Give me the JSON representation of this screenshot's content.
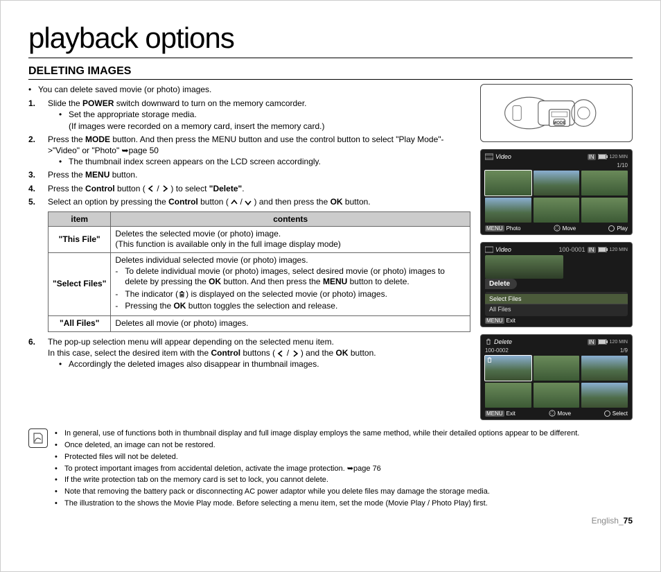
{
  "title": "playback options",
  "subtitle": "DELETING IMAGES",
  "intro_bullet": "You can delete saved movie (or photo) images.",
  "steps": [
    {
      "num": "1.",
      "parts": [
        "Slide the ",
        "POWER",
        " switch downward to turn on the memory camcorder."
      ],
      "subs": [
        [
          "Set the appropriate storage media."
        ],
        [
          "(If images were recorded on a memory card, insert the memory card.)"
        ]
      ]
    },
    {
      "num": "2.",
      "parts": [
        "Press the ",
        "MODE",
        " button. And then press the MENU button and use the control button to select \"Play Mode\"->\"Video\" or \"Photo\" ➥page 50"
      ],
      "subs": [
        [
          "The thumbnail index screen appears on the LCD screen accordingly."
        ]
      ]
    },
    {
      "num": "3.",
      "parts": [
        "Press the ",
        "MENU",
        " button."
      ]
    },
    {
      "num": "4.",
      "parts_a": "Press the ",
      "parts_b": "Control",
      "parts_c": " button ( ",
      "parts_d": " ) to select ",
      "parts_e": "\"Delete\"",
      "parts_f": "."
    },
    {
      "num": "5.",
      "parts_a": "Select an option by pressing the ",
      "parts_b": "Control",
      "parts_c": " button ( ",
      "parts_d": " ) and then press the ",
      "parts_e": "OK",
      "parts_f": " button."
    }
  ],
  "table": {
    "head_item": "item",
    "head_contents": "contents",
    "rows": [
      {
        "item": "\"This File\"",
        "lines": [
          "Deletes the selected movie (or photo) image.",
          "(This function is available only in the full image display mode)"
        ]
      },
      {
        "item": "\"Select Files\"",
        "intro": "Deletes individual selected movie (or photo) images.",
        "dashes": [
          {
            "pre": "To delete individual movie (or photo) images, select desired movie (or photo) images to delete by pressing the ",
            "bold1": "OK",
            "mid": " button. And then press the ",
            "bold2": "MENU",
            "post": " button to delete."
          },
          {
            "pre": "The indicator (",
            "icon": "trash",
            "post": ") is displayed on the selected movie (or photo) images."
          },
          {
            "pre": "Pressing the ",
            "bold1": "OK",
            "post": " button toggles the selection and release."
          }
        ]
      },
      {
        "item": "\"All Files\"",
        "lines": [
          "Deletes all movie (or photo) images."
        ]
      }
    ]
  },
  "step6": {
    "num": "6.",
    "line1_a": "The pop-up selection menu will appear depending on the selected menu item.",
    "line2_a": "In this case, select the desired item with the ",
    "line2_b": "Control",
    "line2_c": " buttons ( ",
    "line2_d": " ) and the ",
    "line2_e": "OK",
    "line2_f": " button.",
    "sub": "Accordingly the deleted images also disappear in thumbnail images."
  },
  "notes": [
    "In general, use of functions both in thumbnail display and full image display employs the same method, while their detailed options appear to be different.",
    "Once deleted, an image can not be restored.",
    "Protected files will not be deleted.",
    "To protect important images from accidental deletion, activate the image protection. ➥page 76",
    "If the write protection tab on the memory card is set to lock, you cannot delete.",
    "Note that removing the battery pack or disconnecting AC power adaptor while you delete files may damage the storage media.",
    "The illustration to the shows the Movie Play mode. Before selecting a menu item, set the mode (Movie Play / Photo Play) first."
  ],
  "footer_lang": "English_",
  "footer_page": "75",
  "lcd1": {
    "title": "Video",
    "counter": "1/10",
    "min": "120 MIN",
    "bot_left": "Photo",
    "bot_mid": "Move",
    "bot_right": "Play",
    "menu_tag": "MENU"
  },
  "lcd2": {
    "title": "Video",
    "id": "100-0001",
    "min": "120 MIN",
    "tab": "Delete",
    "item1": "Select Files",
    "item2": "All Files",
    "bot_left": "Exit",
    "menu_tag": "MENU"
  },
  "lcd3": {
    "title": "Delete",
    "id": "100-0002",
    "min": "120 MIN",
    "counter": "1/9",
    "bot_left": "Exit",
    "bot_mid": "Move",
    "bot_right": "Select",
    "menu_tag": "MENU"
  },
  "icons": {
    "mode_label": "MODE"
  }
}
